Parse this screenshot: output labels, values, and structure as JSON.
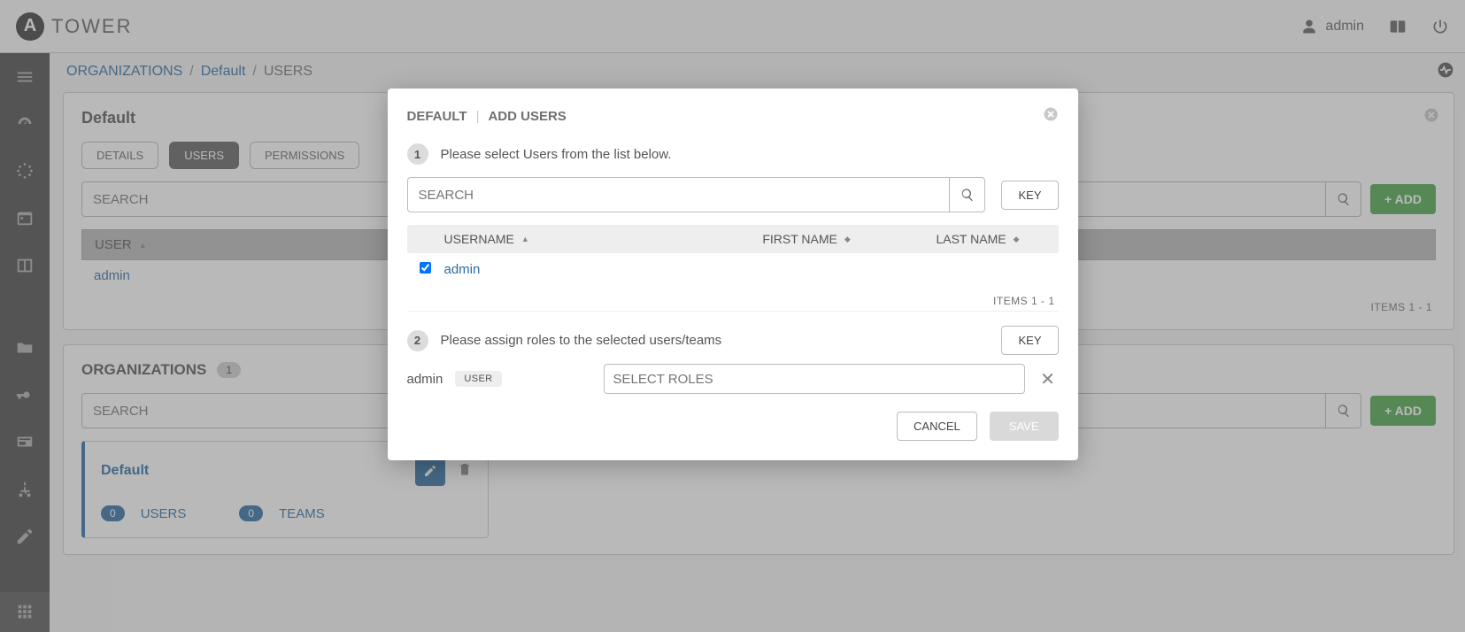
{
  "header": {
    "brand_text": "TOWER",
    "user": "admin"
  },
  "breadcrumb": {
    "org_root": "ORGANIZATIONS",
    "org_name": "Default",
    "current": "USERS"
  },
  "panel": {
    "title": "Default",
    "tabs": {
      "details": "DETAILS",
      "users": "USERS",
      "permissions": "PERMISSIONS"
    },
    "search_placeholder": "SEARCH",
    "add_label": "+ ADD",
    "user_col": "USER",
    "rows": [
      "admin"
    ],
    "items_text": "ITEMS  1 - 1"
  },
  "orgs": {
    "title": "ORGANIZATIONS",
    "count": "1",
    "search_placeholder": "SEARCH",
    "add_label": "+ ADD",
    "card": {
      "name": "Default",
      "users_count": "0",
      "users_label": "USERS",
      "teams_count": "0",
      "teams_label": "TEAMS"
    }
  },
  "modal": {
    "crumb1": "DEFAULT",
    "crumb2": "ADD USERS",
    "step1_num": "1",
    "step1_text": "Please select Users from the list below.",
    "search_placeholder": "SEARCH",
    "key_label": "KEY",
    "cols": {
      "username": "USERNAME",
      "first": "FIRST NAME",
      "last": "LAST NAME"
    },
    "user_rows": [
      {
        "username": "admin",
        "checked": true
      }
    ],
    "items_text": "ITEMS  1 - 1",
    "step2_num": "2",
    "step2_text": "Please assign roles to the selected users/teams",
    "assign": {
      "name": "admin",
      "tag": "USER",
      "roles_placeholder": "SELECT ROLES"
    },
    "cancel": "CANCEL",
    "save": "SAVE"
  }
}
